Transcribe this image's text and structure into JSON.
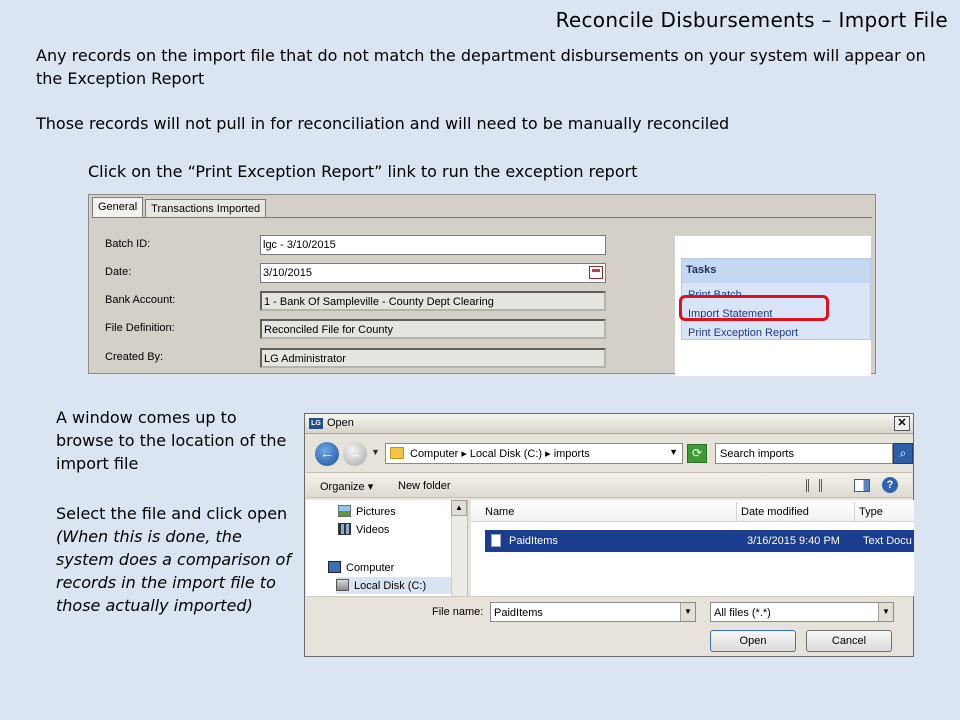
{
  "slide": {
    "title": "Reconcile Disbursements – Import File",
    "para1": "Any records on the import file that do not match the department disbursements on your system will appear on the Exception Report",
    "para2": "Those records will not pull in for reconciliation and will need to be manually reconciled",
    "para3": "Click on the “Print Exception Report” link to run the exception report",
    "para4": "A window comes up to browse to the location of the import file",
    "para5_plain": "Select the file and click open ",
    "para5_italic": "(When this is done, the system does a comparison of records in the import file to those actually imported)"
  },
  "batch_panel": {
    "tabs": [
      "General",
      "Transactions Imported"
    ],
    "fields": [
      {
        "label": "Batch ID:",
        "value": "lgc - 3/10/2015"
      },
      {
        "label": "Date:",
        "value": "3/10/2015"
      },
      {
        "label": "Bank Account:",
        "value": "1 - Bank Of Sampleville - County Dept Clearing"
      },
      {
        "label": "File Definition:",
        "value": "Reconciled File for County"
      },
      {
        "label": "Created By:",
        "value": "LG Administrator"
      }
    ],
    "tasks": {
      "title": "Tasks",
      "links": [
        "Print Batch",
        "Import Statement",
        "Print Exception Report"
      ]
    },
    "highlight_color": "#e0101c"
  },
  "open_dialog": {
    "title": "Open",
    "logo_text": "LG",
    "address": "Computer ▸ Local Disk (C:) ▸ imports",
    "search_placeholder": "Search imports",
    "toolbar": {
      "organize": "Organize ▾",
      "new_folder": "New folder"
    },
    "tree": [
      "Pictures",
      "Videos",
      "Computer",
      "Local Disk (C:)"
    ],
    "columns": [
      "Name",
      "Date modified",
      "Type"
    ],
    "file": {
      "name": "PaidItems",
      "date": "3/16/2015 9:40 PM",
      "type": "Text Docu"
    },
    "file_name_label": "File name:",
    "file_name_value": "PaidItems",
    "filter_value": "All files (*.*)",
    "open_label": "Open",
    "cancel_label": "Cancel"
  }
}
